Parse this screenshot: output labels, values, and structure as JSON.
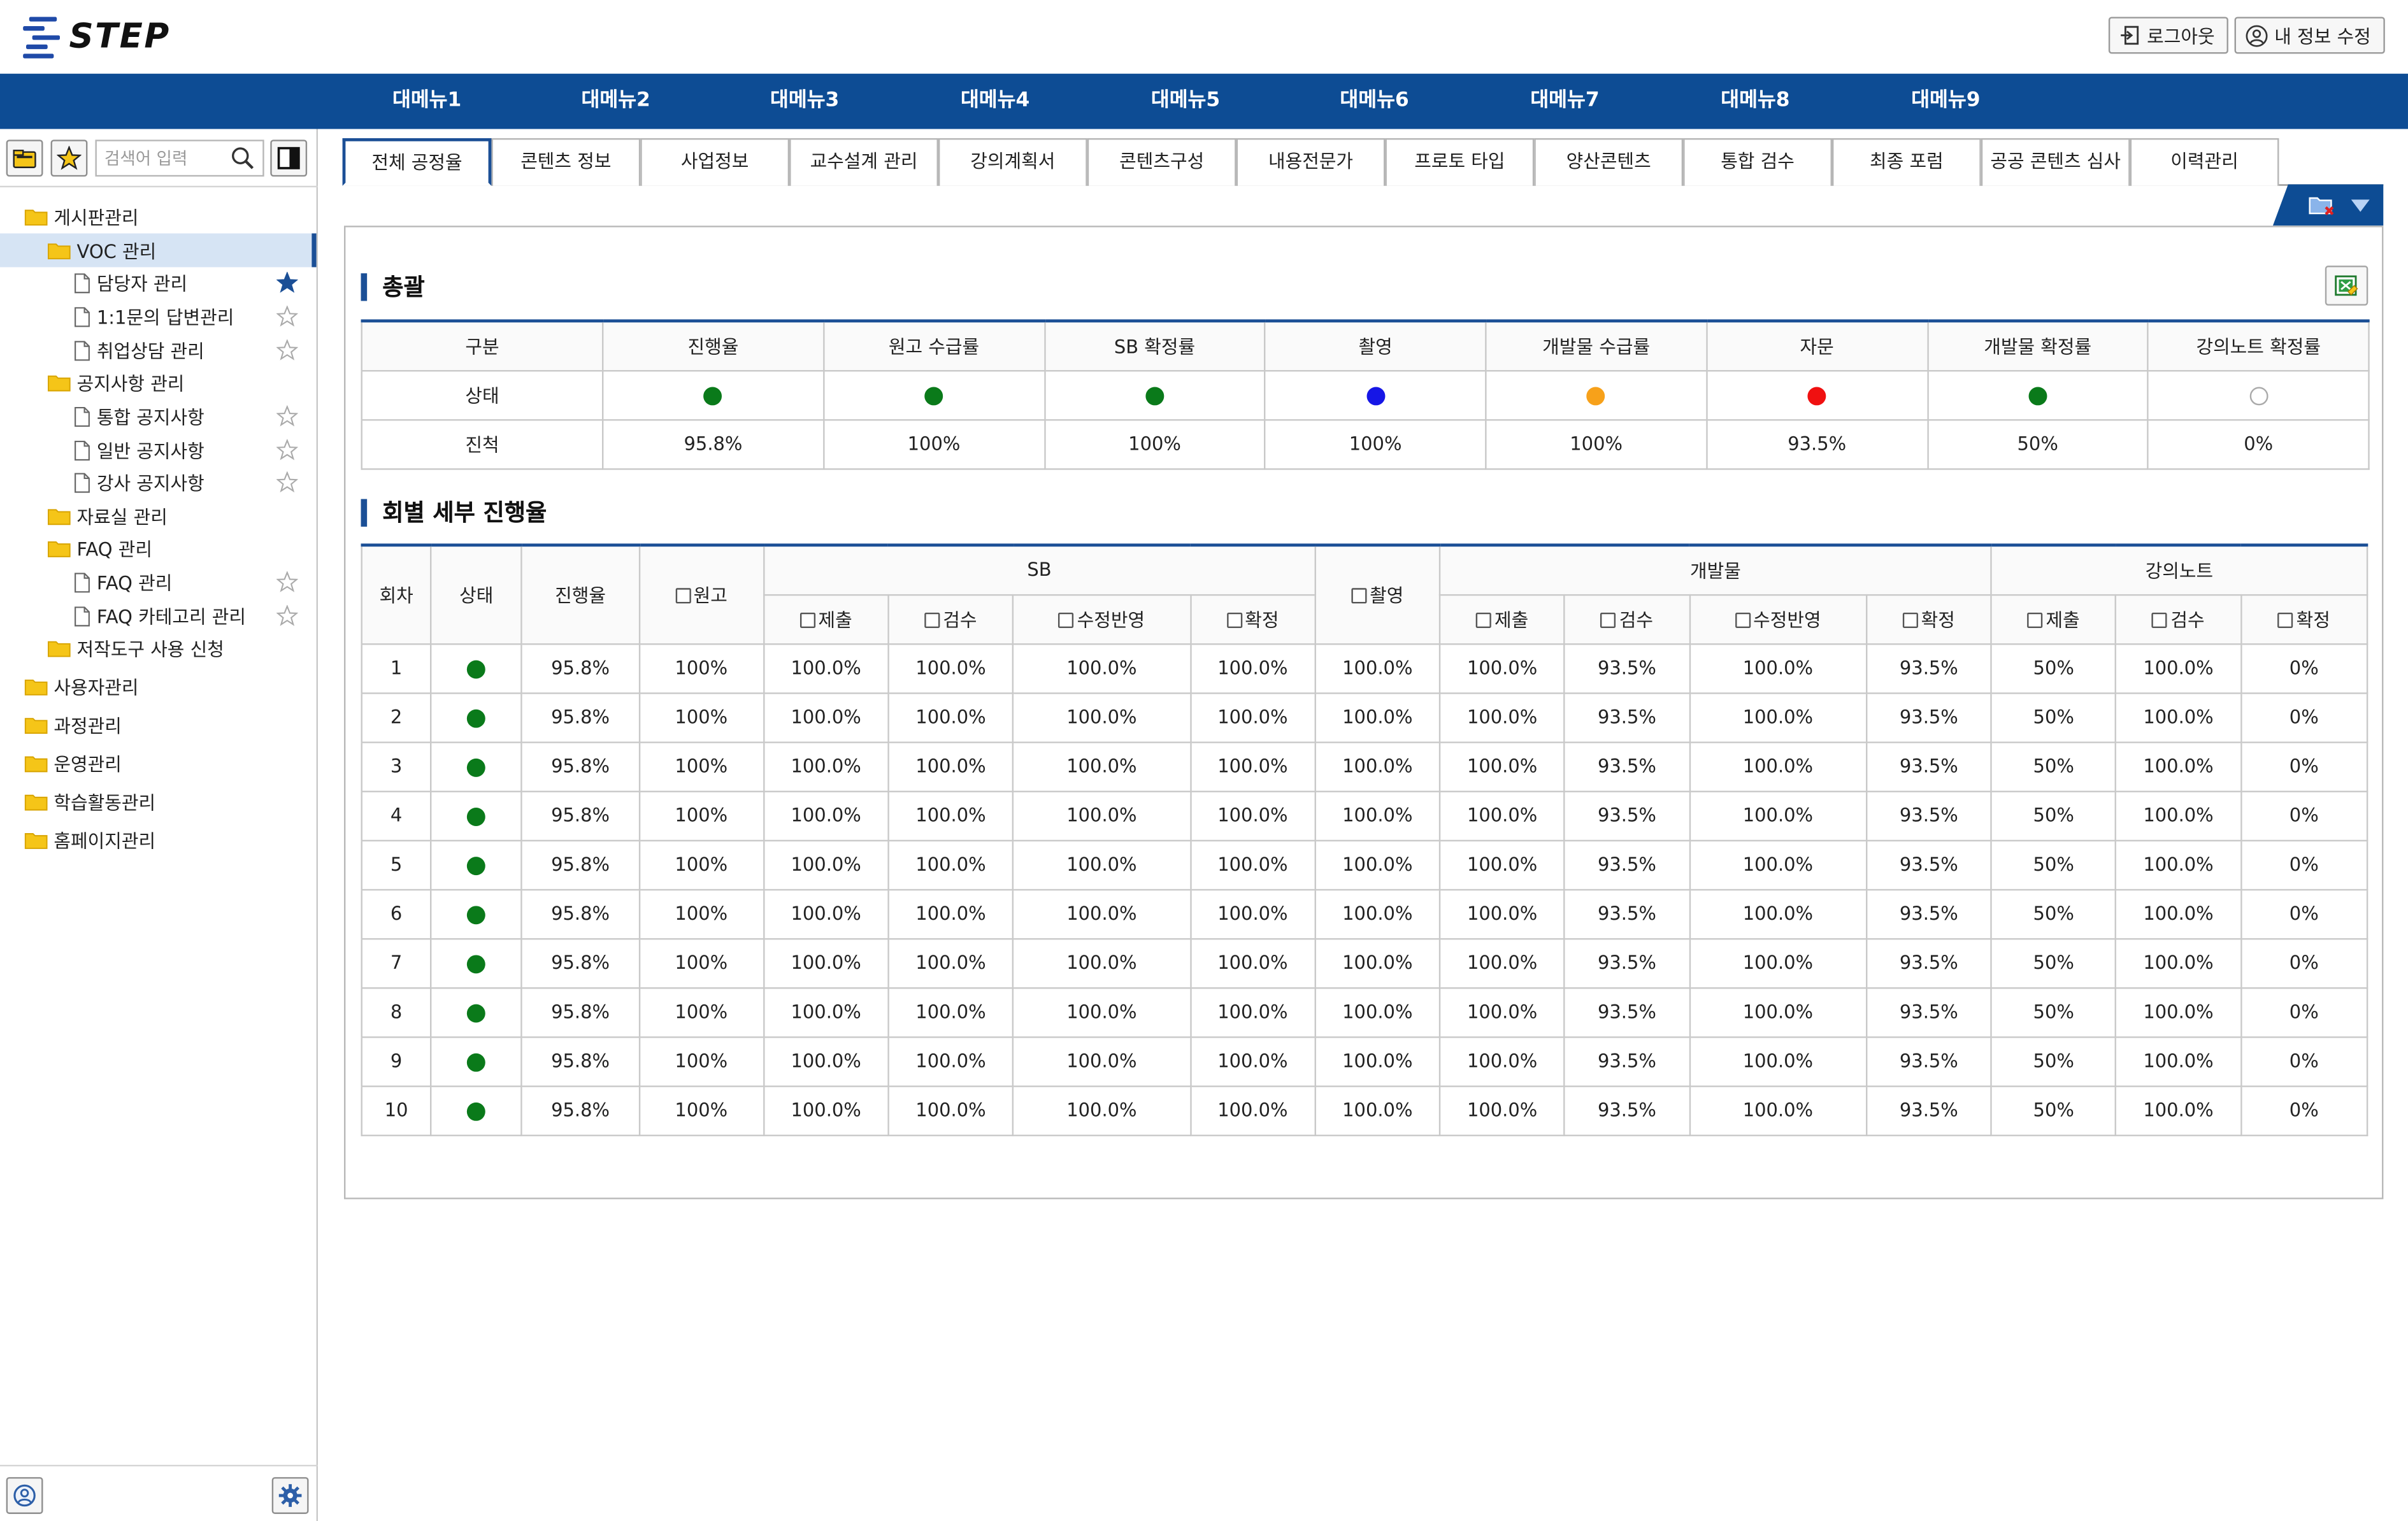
{
  "header": {
    "logo_text": "STEP",
    "logout_label": "로그아웃",
    "edit_profile_label": "내 정보 수정"
  },
  "topnav": [
    "대메뉴1",
    "대메뉴2",
    "대메뉴3",
    "대메뉴4",
    "대메뉴5",
    "대메뉴6",
    "대메뉴7",
    "대메뉴8",
    "대메뉴9"
  ],
  "sidebar": {
    "search_placeholder": "검색어 입력",
    "tree": [
      {
        "label": "게시판관리",
        "type": "folder",
        "level": 0
      },
      {
        "label": "VOC 관리",
        "type": "folder",
        "level": 1,
        "selected": true
      },
      {
        "label": "담당자 관리",
        "type": "file",
        "level": 2,
        "star": "filled"
      },
      {
        "label": "1:1문의 답변관리",
        "type": "file",
        "level": 2,
        "star": "empty"
      },
      {
        "label": "취업상담 관리",
        "type": "file",
        "level": 2,
        "star": "empty"
      },
      {
        "label": "공지사항 관리",
        "type": "folder",
        "level": 1
      },
      {
        "label": "통합 공지사항",
        "type": "file",
        "level": 2,
        "star": "empty"
      },
      {
        "label": "일반 공지사항",
        "type": "file",
        "level": 2,
        "star": "empty"
      },
      {
        "label": "강사 공지사항",
        "type": "file",
        "level": 2,
        "star": "empty"
      },
      {
        "label": "자료실 관리",
        "type": "folder",
        "level": 1
      },
      {
        "label": "FAQ 관리",
        "type": "folder",
        "level": 1
      },
      {
        "label": "FAQ 관리",
        "type": "file",
        "level": 2,
        "star": "empty"
      },
      {
        "label": "FAQ 카테고리 관리",
        "type": "file",
        "level": 2,
        "star": "empty"
      },
      {
        "label": "저작도구 사용 신청",
        "type": "folder",
        "level": 1
      },
      {
        "label": "사용자관리",
        "type": "folder",
        "level": 0
      },
      {
        "label": "과정관리",
        "type": "folder",
        "level": 0
      },
      {
        "label": "운영관리",
        "type": "folder",
        "level": 0
      },
      {
        "label": "학습활동관리",
        "type": "folder",
        "level": 0
      },
      {
        "label": "홈페이지관리",
        "type": "folder",
        "level": 0
      }
    ]
  },
  "tabs": [
    "전체 공정율",
    "콘텐츠 정보",
    "사업정보",
    "교수설계 관리",
    "강의계획서",
    "콘텐츠구성",
    "내용전문가",
    "프로토 타입",
    "양산콘텐츠",
    "통합 검수",
    "최종 포럼",
    "공공 콘텐츠 심사",
    "이력관리"
  ],
  "summary": {
    "title": "총괄",
    "row_labels": {
      "header": "구분",
      "status": "상태",
      "progress": "진척"
    },
    "columns": [
      "진행율",
      "원고 수급률",
      "SB 확정률",
      "촬영",
      "개발물 수급률",
      "자문",
      "개발물 확정률",
      "강의노트 확정률"
    ],
    "status": [
      "green",
      "green",
      "green",
      "blue",
      "orange",
      "red",
      "green",
      "empty"
    ],
    "progress": [
      "95.8%",
      "100%",
      "100%",
      "100%",
      "100%",
      "93.5%",
      "50%",
      "0%"
    ]
  },
  "detail": {
    "title": "회별 세부 진행율",
    "headers": {
      "round": "회차",
      "status": "상태",
      "progress": "진행율",
      "manuscript": "원고",
      "sb": "SB",
      "filming": "촬영",
      "dev": "개발물",
      "lecture": "강의노트",
      "submit": "제출",
      "review": "검수",
      "revision": "수정반영",
      "confirm": "확정"
    },
    "rows": [
      {
        "round": "1",
        "status": "green",
        "values": [
          "95.8%",
          "100%",
          "100.0%",
          "100.0%",
          "100.0%",
          "100.0%",
          "100.0%",
          "100.0%",
          "93.5%",
          "100.0%",
          "93.5%",
          "50%",
          "100.0%",
          "0%"
        ]
      },
      {
        "round": "2",
        "status": "green",
        "values": [
          "95.8%",
          "100%",
          "100.0%",
          "100.0%",
          "100.0%",
          "100.0%",
          "100.0%",
          "100.0%",
          "93.5%",
          "100.0%",
          "93.5%",
          "50%",
          "100.0%",
          "0%"
        ]
      },
      {
        "round": "3",
        "status": "green",
        "values": [
          "95.8%",
          "100%",
          "100.0%",
          "100.0%",
          "100.0%",
          "100.0%",
          "100.0%",
          "100.0%",
          "93.5%",
          "100.0%",
          "93.5%",
          "50%",
          "100.0%",
          "0%"
        ]
      },
      {
        "round": "4",
        "status": "green",
        "values": [
          "95.8%",
          "100%",
          "100.0%",
          "100.0%",
          "100.0%",
          "100.0%",
          "100.0%",
          "100.0%",
          "93.5%",
          "100.0%",
          "93.5%",
          "50%",
          "100.0%",
          "0%"
        ]
      },
      {
        "round": "5",
        "status": "green",
        "values": [
          "95.8%",
          "100%",
          "100.0%",
          "100.0%",
          "100.0%",
          "100.0%",
          "100.0%",
          "100.0%",
          "93.5%",
          "100.0%",
          "93.5%",
          "50%",
          "100.0%",
          "0%"
        ]
      },
      {
        "round": "6",
        "status": "green",
        "values": [
          "95.8%",
          "100%",
          "100.0%",
          "100.0%",
          "100.0%",
          "100.0%",
          "100.0%",
          "100.0%",
          "93.5%",
          "100.0%",
          "93.5%",
          "50%",
          "100.0%",
          "0%"
        ]
      },
      {
        "round": "7",
        "status": "green",
        "values": [
          "95.8%",
          "100%",
          "100.0%",
          "100.0%",
          "100.0%",
          "100.0%",
          "100.0%",
          "100.0%",
          "93.5%",
          "100.0%",
          "93.5%",
          "50%",
          "100.0%",
          "0%"
        ]
      },
      {
        "round": "8",
        "status": "green",
        "values": [
          "95.8%",
          "100%",
          "100.0%",
          "100.0%",
          "100.0%",
          "100.0%",
          "100.0%",
          "100.0%",
          "93.5%",
          "100.0%",
          "93.5%",
          "50%",
          "100.0%",
          "0%"
        ]
      },
      {
        "round": "9",
        "status": "green",
        "values": [
          "95.8%",
          "100%",
          "100.0%",
          "100.0%",
          "100.0%",
          "100.0%",
          "100.0%",
          "100.0%",
          "93.5%",
          "100.0%",
          "93.5%",
          "50%",
          "100.0%",
          "0%"
        ]
      },
      {
        "round": "10",
        "status": "green",
        "values": [
          "95.8%",
          "100%",
          "100.0%",
          "100.0%",
          "100.0%",
          "100.0%",
          "100.0%",
          "100.0%",
          "93.5%",
          "100.0%",
          "93.5%",
          "50%",
          "100.0%",
          "0%"
        ]
      }
    ]
  },
  "colors": {
    "brand": "#0d4c94",
    "accent": "#1b4f96",
    "status_green": "#0a7a1a",
    "status_blue": "#1616e6",
    "status_orange": "#f7a11a",
    "status_red": "#f01010",
    "selected_bg": "#d6e4f4"
  }
}
